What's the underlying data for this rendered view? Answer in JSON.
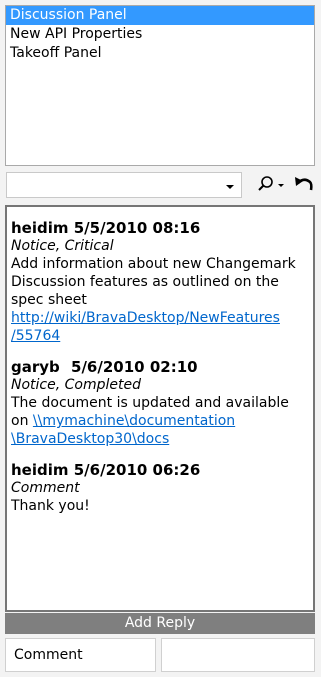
{
  "list": {
    "items": [
      {
        "label": "Discussion Panel",
        "selected": true
      },
      {
        "label": "New API Properties",
        "selected": false
      },
      {
        "label": "Takeoff Panel",
        "selected": false
      }
    ]
  },
  "toolbar": {
    "combo_value": "",
    "icons": [
      "dropdown-arrow-icon",
      "search-icon",
      "undo-icon"
    ]
  },
  "discussion": {
    "entries": [
      {
        "user": "heidim",
        "date": "5/5/2010 08:16",
        "status": "Notice, Critical",
        "text": "Add information about new Changemark Discussion features as outlined on the spec sheet",
        "link_line1": "http://wiki/BravaDesktop/NewFeatures",
        "link_line2": "/55764"
      },
      {
        "user": "garyb",
        "date": "5/6/2010 02:10",
        "status": "Notice, Completed",
        "text": "The document is updated and available on",
        "link_line1": "\\\\mymachine\\documentation",
        "link_line2": "\\BravaDesktop30\\docs"
      },
      {
        "user": "heidim",
        "date": "5/6/2010 06:26",
        "status": "Comment",
        "text": "Thank you!"
      }
    ]
  },
  "reply": {
    "add_reply_label": "Add Reply",
    "type_value": "Comment"
  },
  "colors": {
    "selection": "#3399ff",
    "link": "#0066cc",
    "reply_bar": "#7f7f7f"
  }
}
